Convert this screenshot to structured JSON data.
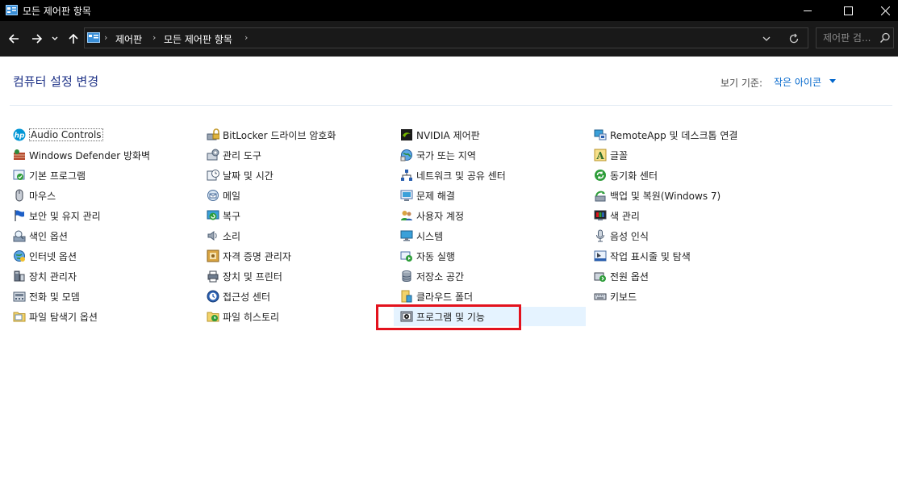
{
  "window": {
    "title": "모든 제어판 항목"
  },
  "breadcrumb": [
    "제어판",
    "모든 제어판 항목"
  ],
  "search": {
    "placeholder": "제어판 검..."
  },
  "header": {
    "title": "컴퓨터 설정 변경",
    "view_label": "보기 기준:",
    "view_value": "작은 아이콘"
  },
  "columns": [
    [
      {
        "label": "Audio Controls",
        "icon": "hp-icon"
      },
      {
        "label": "Windows Defender 방화벽",
        "icon": "firewall-icon"
      },
      {
        "label": "기본 프로그램",
        "icon": "default-programs-icon"
      },
      {
        "label": "마우스",
        "icon": "mouse-icon"
      },
      {
        "label": "보안 및 유지 관리",
        "icon": "flag-icon"
      },
      {
        "label": "색인 옵션",
        "icon": "indexing-icon"
      },
      {
        "label": "인터넷 옵션",
        "icon": "internet-options-icon"
      },
      {
        "label": "장치 관리자",
        "icon": "device-manager-icon"
      },
      {
        "label": "전화 및 모뎀",
        "icon": "phone-modem-icon"
      },
      {
        "label": "파일 탐색기 옵션",
        "icon": "folder-options-icon"
      }
    ],
    [
      {
        "label": "BitLocker 드라이브 암호화",
        "icon": "bitlocker-icon"
      },
      {
        "label": "관리 도구",
        "icon": "admin-tools-icon"
      },
      {
        "label": "날짜 및 시간",
        "icon": "date-time-icon"
      },
      {
        "label": "메일",
        "icon": "mail-icon"
      },
      {
        "label": "복구",
        "icon": "recovery-icon"
      },
      {
        "label": "소리",
        "icon": "speaker-icon"
      },
      {
        "label": "자격 증명 관리자",
        "icon": "credential-icon"
      },
      {
        "label": "장치 및 프린터",
        "icon": "printer-icon"
      },
      {
        "label": "접근성 센터",
        "icon": "accessibility-icon"
      },
      {
        "label": "파일 히스토리",
        "icon": "file-history-icon"
      }
    ],
    [
      {
        "label": "NVIDIA 제어판",
        "icon": "nvidia-icon"
      },
      {
        "label": "국가 또는 지역",
        "icon": "region-icon"
      },
      {
        "label": "네트워크 및 공유 센터",
        "icon": "network-icon"
      },
      {
        "label": "문제 해결",
        "icon": "troubleshoot-icon"
      },
      {
        "label": "사용자 계정",
        "icon": "user-accounts-icon"
      },
      {
        "label": "시스템",
        "icon": "system-icon"
      },
      {
        "label": "자동 실행",
        "icon": "autoplay-icon"
      },
      {
        "label": "저장소 공간",
        "icon": "storage-icon"
      },
      {
        "label": "클라우드 폴더",
        "icon": "cloud-folder-icon"
      },
      {
        "label": "프로그램 및 기능",
        "icon": "programs-features-icon"
      }
    ],
    [
      {
        "label": "RemoteApp 및 데스크톱 연결",
        "icon": "remoteapp-icon"
      },
      {
        "label": "글꼴",
        "icon": "fonts-icon"
      },
      {
        "label": "동기화 센터",
        "icon": "sync-icon"
      },
      {
        "label": "백업 및 복원(Windows 7)",
        "icon": "backup-icon"
      },
      {
        "label": "색 관리",
        "icon": "color-management-icon"
      },
      {
        "label": "음성 인식",
        "icon": "microphone-icon"
      },
      {
        "label": "작업 표시줄 및 탐색",
        "icon": "taskbar-icon"
      },
      {
        "label": "전원 옵션",
        "icon": "power-icon"
      },
      {
        "label": "키보드",
        "icon": "keyboard-icon"
      }
    ]
  ],
  "selected_item": "프로그램 및 기능",
  "colors": {
    "title_blue": "#1e3287",
    "link_blue": "#0066cc",
    "highlight_red": "#e3121d",
    "selected_bg": "#e5f3ff"
  }
}
